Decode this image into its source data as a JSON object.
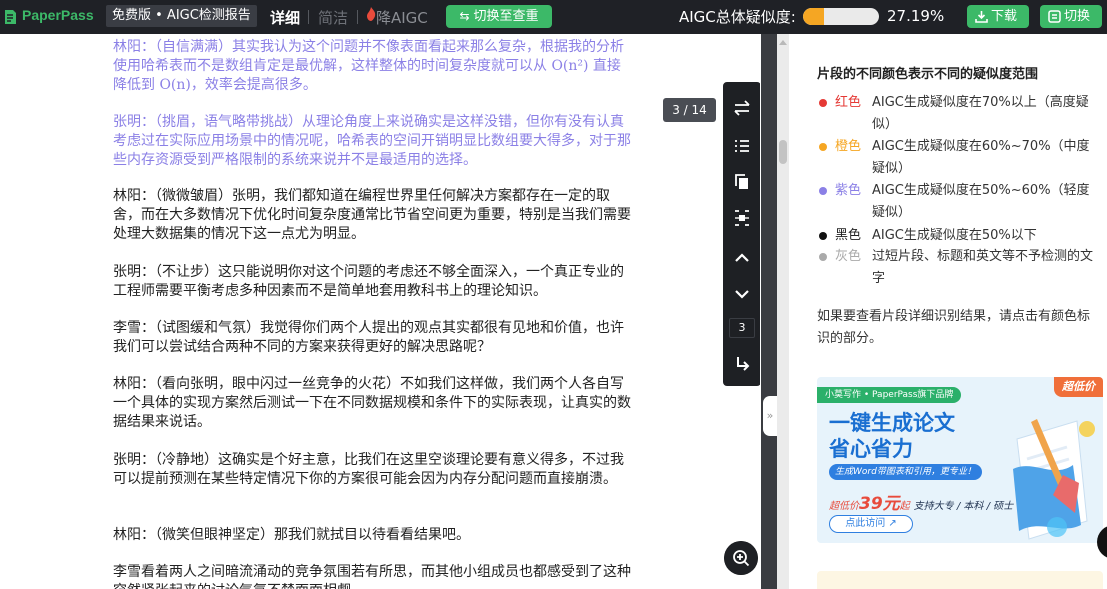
{
  "header": {
    "brand": "PaperPass",
    "edition": "免费版 • AIGC检测报告",
    "tabs": {
      "detail": "详细",
      "simple": "简洁",
      "reduce": "降AIGC"
    },
    "switch_button": "切换至查重",
    "overall_label": "AIGC总体疑似度:",
    "overall_fraction": 0.2719,
    "overall_percent": "27.19%",
    "download_button": "下载",
    "toggle_button": "切换",
    "colors": {
      "bar_bg": "#1f2126",
      "accent": "#3cb968",
      "progress": "#f5a623"
    }
  },
  "document": {
    "page_indicator": "3 / 14",
    "paragraph_counter": "3",
    "paragraphs": [
      {
        "level": "purple",
        "text": "林阳：（自信满满）其实我认为这个问题并不像表面看起来那么复杂，根据我的分析使用哈希表而不是数组肯定是最优解，这样整体的时间复杂度就可以从 O(n²) 直接降低到 O(n)，效率会提高很多。"
      },
      {
        "level": "purple",
        "text": "张明：（挑眉，语气略带挑战）从理论角度上来说确实是这样没错，但你有没有认真考虑过在实际应用场景中的情况呢，哈希表的空间开销明显比数组要大得多，对于那些内存资源受到严格限制的系统来说并不是最适用的选择。"
      },
      {
        "level": "black",
        "text": "林阳：（微微皱眉）张明，我们都知道在编程世界里任何解决方案都存在一定的取舍，而在大多数情况下优化时间复杂度通常比节省空间更为重要，特别是当我们需要处理大数据集的情况下这一点尤为明显。"
      },
      {
        "level": "black",
        "text": "张明：（不让步）这只能说明你对这个问题的考虑还不够全面深入，一个真正专业的工程师需要平衡考虑多种因素而不是简单地套用教科书上的理论知识。"
      },
      {
        "level": "black",
        "text": "李雪：（试图缓和气氛）我觉得你们两个人提出的观点其实都很有见地和价值，也许我们可以尝试结合两种不同的方案来获得更好的解决思路呢？"
      },
      {
        "level": "black",
        "text": "林阳：（看向张明，眼中闪过一丝竞争的火花）不如我们这样做，我们两个人各自写一个具体的实现方案然后测试一下在不同数据规模和条件下的实际表现，让真实的数据结果来说话。"
      },
      {
        "level": "black",
        "text": "张明：（冷静地）这确实是个好主意，比我们在这里空谈理论要有意义得多，不过我可以提前预测在某些特定情况下你的方案很可能会因为内存分配问题而直接崩溃。"
      },
      {
        "level": "black",
        "text": "林阳：（微笑但眼神坚定）那我们就拭目以待看看结果吧。"
      },
      {
        "level": "black",
        "text": "李雪看着两人之间暗流涌动的竞争氛围若有所思，而其他小组成员也都感受到了这种突然紧张起来的讨论气氛不禁面面相觑。"
      }
    ]
  },
  "legend": {
    "title": "片段的不同颜色表示不同的疑似度范围",
    "items": [
      {
        "color": "#e53935",
        "name": "红色",
        "desc": "AIGC生成疑似度在70%以上（高度疑似）"
      },
      {
        "color": "#f5a623",
        "name": "橙色",
        "desc": "AIGC生成疑似度在60%~70%（中度疑似）"
      },
      {
        "color": "#8b80e6",
        "name": "紫色",
        "desc": "AIGC生成疑似度在50%~60%（轻度疑似）"
      },
      {
        "color": "#111111",
        "name": "黑色",
        "desc": "AIGC生成疑似度在50%以下"
      },
      {
        "color": "#aaaaaa",
        "name": "灰色",
        "desc": "过短片段、标题和英文等不予检测的文字"
      }
    ],
    "hint": "如果要查看片段详细识别结果，请点击有颜色标识的部分。"
  },
  "ad": {
    "tag": "小莫写作 • PaperPass旗下品牌",
    "corner": "超低价",
    "title_line1": "一键生成论文",
    "title_line2": "省心省力",
    "badge": "生成Word带图表和引用，更专业！",
    "price_prefix": "超低价",
    "price": "39元",
    "price_suffix": "起",
    "support": "支持大专 / 本科 / 硕士",
    "button": "点此访问"
  }
}
